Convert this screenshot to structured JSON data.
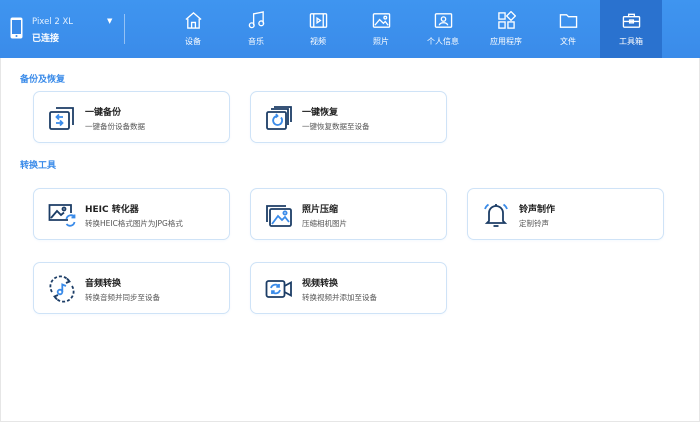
{
  "device": {
    "name": "Pixel 2 XL",
    "status": "已连接",
    "caret": "▼"
  },
  "nav": {
    "tabs": [
      {
        "label": "设备",
        "icon": "device-icon"
      },
      {
        "label": "音乐",
        "icon": "music-icon"
      },
      {
        "label": "视频",
        "icon": "video-icon"
      },
      {
        "label": "照片",
        "icon": "photo-icon"
      },
      {
        "label": "个人信息",
        "icon": "contact-card-icon"
      },
      {
        "label": "应用程序",
        "icon": "apps-icon"
      },
      {
        "label": "文件",
        "icon": "folder-icon"
      },
      {
        "label": "工具箱",
        "icon": "toolbox-icon"
      }
    ],
    "active": "工具箱"
  },
  "sections": {
    "backup": {
      "title": "备份及恢复",
      "cards": [
        {
          "title": "一键备份",
          "desc": "一键备份设备数据",
          "icon": "backup-icon"
        },
        {
          "title": "一键恢复",
          "desc": "一键恢复数据至设备",
          "icon": "restore-icon"
        }
      ]
    },
    "convert": {
      "title": "转换工具",
      "cards": [
        {
          "title": "HEIC 转化器",
          "desc": "转换HEIC格式图片为JPG格式",
          "icon": "heic-convert-icon"
        },
        {
          "title": "照片压缩",
          "desc": "压缩相机图片",
          "icon": "photo-compress-icon"
        },
        {
          "title": "铃声制作",
          "desc": "定制铃声",
          "icon": "bell-icon"
        },
        {
          "title": "音频转换",
          "desc": "转换音频并同步至设备",
          "icon": "audio-convert-icon"
        },
        {
          "title": "视频转换",
          "desc": "转换视频并添加至设备",
          "icon": "video-convert-icon"
        }
      ]
    }
  },
  "colors": {
    "topbar": "#3a8be9",
    "active_tab": "#2a72cf",
    "accent": "#3a8be9",
    "card_border": "#cfe3f7",
    "icon_dark": "#1c3d66"
  }
}
